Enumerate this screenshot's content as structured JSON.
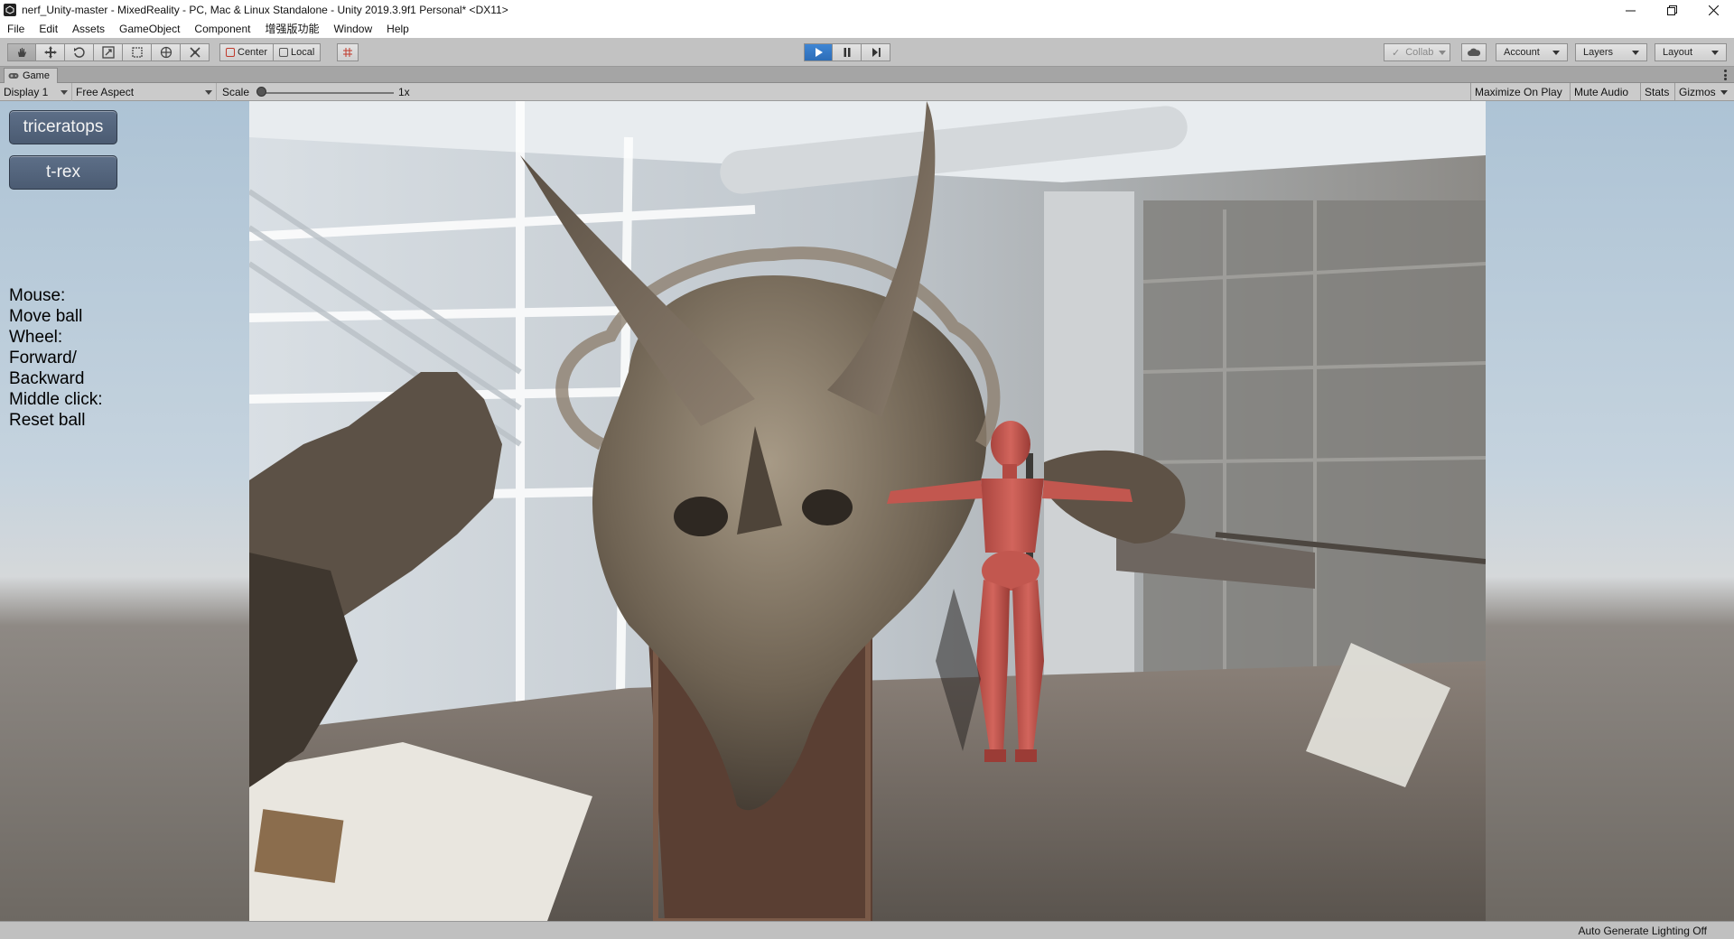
{
  "window": {
    "title": "nerf_Unity-master - MixedReality - PC, Mac & Linux Standalone - Unity 2019.3.9f1 Personal* <DX11>"
  },
  "menu": {
    "items": [
      "File",
      "Edit",
      "Assets",
      "GameObject",
      "Component",
      "增强版功能",
      "Window",
      "Help"
    ]
  },
  "toolbar": {
    "tools": [
      "hand-icon",
      "move-icon",
      "rotate-icon",
      "scale-icon",
      "rect-icon",
      "transform-icon",
      "custom-tool-icon"
    ],
    "pivot_label": "Center",
    "space_label": "Local",
    "collab_label": "Collab",
    "account_label": "Account",
    "layers_label": "Layers",
    "layout_label": "Layout",
    "play_color": "#2d6db8"
  },
  "game_tab": {
    "label": "Game"
  },
  "game_bar": {
    "display": "Display 1",
    "aspect": "Free Aspect",
    "scale_label": "Scale",
    "scale_value": "1x",
    "maximize": "Maximize On Play",
    "mute": "Mute Audio",
    "stats": "Stats",
    "gizmos": "Gizmos"
  },
  "gui": {
    "button_triceratops": "triceratops",
    "button_trex": "t-rex",
    "help": "Mouse:\nMove ball\nWheel:\nForward/\nBackward\nMiddle click:\nReset ball"
  },
  "status": {
    "text": "Auto Generate Lighting Off"
  }
}
